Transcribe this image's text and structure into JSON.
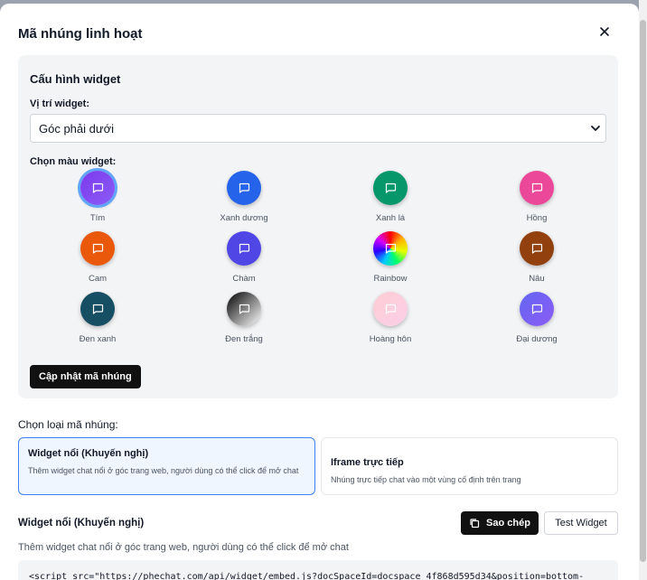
{
  "modal": {
    "title": "Mã nhúng linh hoạt",
    "close_icon": "close-icon"
  },
  "config": {
    "title": "Cấu hình widget",
    "position_label": "Vị trí widget:",
    "position_value": "Góc phải dưới",
    "color_label": "Chọn màu widget:",
    "colors": [
      {
        "name": "Tím",
        "bg": "linear-gradient(135deg,#7c3aed,#8b5cf6)",
        "selected": true,
        "icon_color": "#ffffff"
      },
      {
        "name": "Xanh dương",
        "bg": "#2563eb",
        "selected": false,
        "icon_color": "#ffffff"
      },
      {
        "name": "Xanh lá",
        "bg": "#059669",
        "selected": false,
        "icon_color": "#ffffff"
      },
      {
        "name": "Hồng",
        "bg": "#ec4899",
        "selected": false,
        "icon_color": "#ffffff"
      },
      {
        "name": "Cam",
        "bg": "#ea580c",
        "selected": false,
        "icon_color": "#ffffff"
      },
      {
        "name": "Chàm",
        "bg": "#4f46e5",
        "selected": false,
        "icon_color": "#ffffff"
      },
      {
        "name": "Rainbow",
        "bg": "conic-gradient(#ff0000,#ffb400,#e5ff00,#00ff6a,#00c8ff,#2b00ff,#d400ff,#ff0000)",
        "selected": false,
        "icon_color": "#ffffff"
      },
      {
        "name": "Nâu",
        "bg": "#92400e",
        "selected": false,
        "icon_color": "#ffffff"
      },
      {
        "name": "Đen xanh",
        "bg": "#164e63",
        "selected": false,
        "icon_color": "#ffffff"
      },
      {
        "name": "Đen trắng",
        "bg": "linear-gradient(135deg,#000000,#ffffff)",
        "selected": false,
        "icon_color": "#ffffff"
      },
      {
        "name": "Hoàng hôn",
        "bg": "linear-gradient(135deg,#fecdd3,#fbcfe8)",
        "selected": false,
        "icon_color": "#ffffff"
      },
      {
        "name": "Đại dương",
        "bg": "linear-gradient(135deg,#6366f1,#8b5cf6)",
        "selected": false,
        "icon_color": "#ffffff"
      }
    ],
    "update_button": "Cập nhật mã nhúng"
  },
  "embed": {
    "label": "Chọn loại mã nhúng:",
    "options": [
      {
        "title": "Widget nổi (Khuyến nghị)",
        "description": "Thêm widget chat nổi ở góc trang web, người dùng có thể click để mở chat",
        "active": true
      },
      {
        "title": "Iframe trực tiếp",
        "description": "Nhúng trực tiếp chat vào một vùng cố định trên trang",
        "active": false
      }
    ]
  },
  "section": {
    "title": "Widget nổi (Khuyến nghị)",
    "copy_button": "Sao chép",
    "test_button": "Test Widget",
    "description": "Thêm widget chat nổi ở góc trang web, người dùng có thể click để mở chat",
    "code": "<script src=\"https://phechat.com/api/widget/embed.js?docSpaceId=docspace_4f868d595d34&position=bottom-"
  },
  "colors": {
    "accent": "#3b82f6",
    "dark_button": "#111111",
    "card_bg": "#f3f4f6"
  }
}
